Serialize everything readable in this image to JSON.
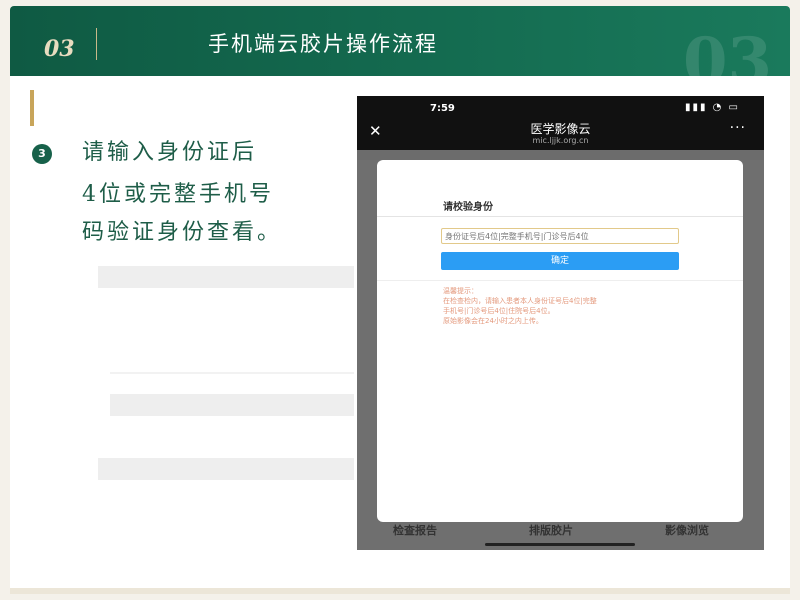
{
  "header": {
    "section_number": "03",
    "title": "手机端云胶片操作流程",
    "watermark": "03"
  },
  "step": {
    "number": "3",
    "lines": [
      "请输入身份证后",
      "4位或完整手机号",
      "码验证身份查看。"
    ]
  },
  "phone": {
    "status": {
      "time": "7:59",
      "icons": "▮▮▮ ◔ ▭"
    },
    "nav": {
      "title": "医学影像云",
      "subtitle": "mic.ljjk.org.cn",
      "close": "✕",
      "more": "···"
    },
    "modal": {
      "title": "请校验身份",
      "input_placeholder": "身份证号后4位|完整手机号|门诊号后4位",
      "confirm_label": "确定",
      "tips": [
        "温馨提示：",
        "在检查检内，请输入患者本人身份证号后4位|完整",
        "手机号|门诊号后4位|住院号后4位。",
        "原始影像会在24小时之内上传。"
      ]
    },
    "bottom_tabs": [
      "检查报告",
      "排版胶片",
      "影像浏览"
    ]
  },
  "colors": {
    "header_green": "#146b50",
    "accent_gold": "#c8a55a",
    "text_green": "#1e5d48",
    "button_blue": "#2b9df4",
    "tip_orange": "#e49a7e"
  }
}
